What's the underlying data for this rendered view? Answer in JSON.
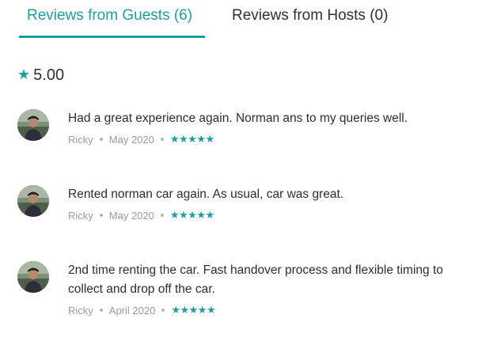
{
  "tabs": {
    "guests_label": "Reviews from Guests (6)",
    "hosts_label": "Reviews from Hosts (0)"
  },
  "rating": {
    "star_icon": "★",
    "value": "5.00"
  },
  "reviews": [
    {
      "text": "Had a great experience again. Norman ans to my queries well.",
      "author": "Ricky",
      "date": "May 2020",
      "stars": "★★★★★",
      "rating": 5
    },
    {
      "text": "Rented norman car again. As usual, car was great.",
      "author": "Ricky",
      "date": "May 2020",
      "stars": "★★★★★",
      "rating": 5
    },
    {
      "text": "2nd time renting the car. Fast handover process and flexible timing to collect and drop off the car.",
      "author": "Ricky",
      "date": "April 2020",
      "stars": "★★★★★",
      "rating": 5
    }
  ],
  "colors": {
    "accent": "#1a9fa5",
    "text": "#2d2d2d",
    "muted": "#9a9a9a"
  }
}
